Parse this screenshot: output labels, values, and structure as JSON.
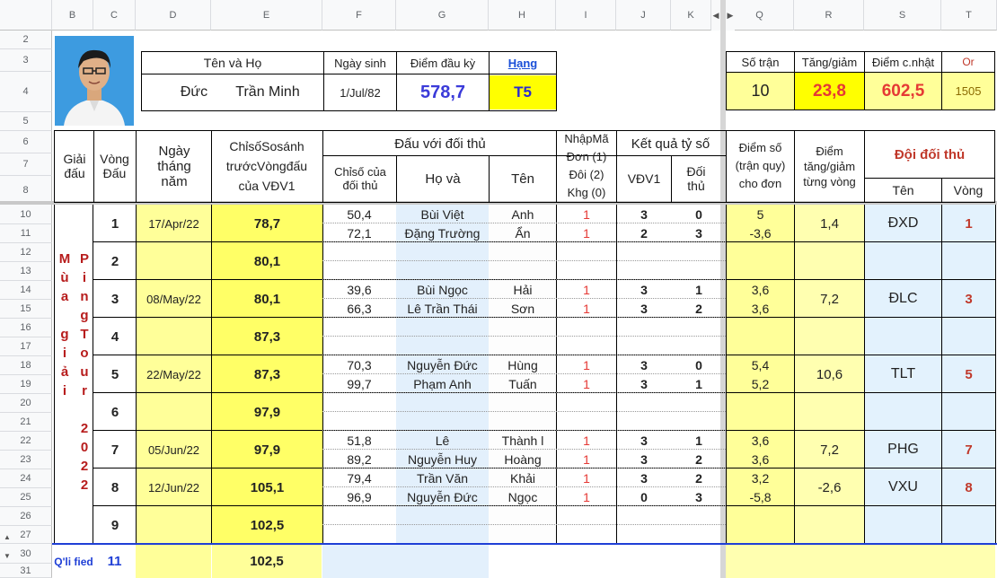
{
  "col_headers": [
    "B",
    "C",
    "D",
    "E",
    "F",
    "G",
    "H",
    "I",
    "J",
    "K",
    "Q",
    "R",
    "S",
    "T"
  ],
  "row_headers": [
    "2",
    "3",
    "4",
    "5",
    "6",
    "7",
    "8",
    "10",
    "11",
    "12",
    "13",
    "14",
    "15",
    "16",
    "17",
    "18",
    "19",
    "20",
    "21",
    "22",
    "23",
    "24",
    "25",
    "26",
    "27",
    "30",
    "31"
  ],
  "info": {
    "ten_va_ho": "Tên    và    Họ",
    "ngay_sinh_label": "Ngày sinh",
    "diem_dau_ky_label": "Điểm đầu kỳ",
    "hang_label": "Hạng",
    "first_name": "Đức",
    "last_name": "Trần Minh",
    "dob": "1/Jul/82",
    "diem_dau_ky": "578,7",
    "hang": "T5"
  },
  "summary": {
    "so_tran_label": "Số trận",
    "tang_giam_label": "Tăng/giảm",
    "diem_cn_label": "Điểm c.nhật",
    "or_label": "Or",
    "so_tran": "10",
    "tang_giam": "23,8",
    "diem_cn": "602,5",
    "or_val": "1505"
  },
  "headers": {
    "giai_dau": "Giải đấu",
    "vong_dau": "Vòng Đấu",
    "ngay": "Ngày tháng năm",
    "chiso": "ChỉsốSosánh trướcVòngđấu của VĐV1",
    "dau_voi": "Đấu với đối thủ",
    "chiso_dt": "Chỉsố của đối thủ",
    "ho_va": "Họ   và",
    "ten": "Tên",
    "nhap_ma": "NhậpMã Đơn (1) Đôi (2) Khg (0)",
    "ket_qua": "Kết quả tỷ số",
    "vdv1": "VĐV1",
    "doi_thu": "Đối thủ",
    "diem_so": "Điểm số (trận quy) cho đơn",
    "diem_tg": "Điểm tăng/giảm từng vòng",
    "doi_doi_thu": "Đội đối thủ",
    "ten2": "Tên",
    "vong2": "Vòng"
  },
  "tournament": {
    "col1": [
      "M",
      "ù",
      "a",
      "",
      "g",
      "i",
      "ả",
      "i"
    ],
    "col2": [
      "P",
      "i",
      "n",
      "g",
      "T",
      "o",
      "u",
      "r",
      "",
      "2",
      "0",
      "2",
      "2"
    ]
  },
  "matches": [
    {
      "round": "1",
      "date": "17/Apr/22",
      "index": "78,7",
      "diem_tg": "1,4",
      "team": "ĐXD",
      "team_round": "1",
      "games": [
        {
          "opp": "50,4",
          "ho": "Bùi Việt",
          "ten": "Anh",
          "code": "1",
          "s1": "3",
          "s2": "0",
          "pts": "5"
        },
        {
          "opp": "72,1",
          "ho": "Đặng Trường",
          "ten": "Ẩn",
          "code": "1",
          "s1": "2",
          "s2": "3",
          "pts": "-3,6"
        }
      ]
    },
    {
      "round": "2",
      "date": "",
      "index": "80,1",
      "diem_tg": "",
      "team": "",
      "team_round": "",
      "games": []
    },
    {
      "round": "3",
      "date": "08/May/22",
      "index": "80,1",
      "diem_tg": "7,2",
      "team": "ĐLC",
      "team_round": "3",
      "games": [
        {
          "opp": "39,6",
          "ho": "Bùi Ngọc",
          "ten": "Hải",
          "code": "1",
          "s1": "3",
          "s2": "1",
          "pts": "3,6"
        },
        {
          "opp": "66,3",
          "ho": "Lê Trần Thái",
          "ten": "Sơn",
          "code": "1",
          "s1": "3",
          "s2": "2",
          "pts": "3,6"
        }
      ]
    },
    {
      "round": "4",
      "date": "",
      "index": "87,3",
      "diem_tg": "",
      "team": "",
      "team_round": "",
      "games": []
    },
    {
      "round": "5",
      "date": "22/May/22",
      "index": "87,3",
      "diem_tg": "10,6",
      "team": "TLT",
      "team_round": "5",
      "games": [
        {
          "opp": "70,3",
          "ho": "Nguyễn Đức",
          "ten": "Hùng",
          "code": "1",
          "s1": "3",
          "s2": "0",
          "pts": "5,4"
        },
        {
          "opp": "99,7",
          "ho": "Phạm Anh",
          "ten": "Tuấn",
          "code": "1",
          "s1": "3",
          "s2": "1",
          "pts": "5,2"
        }
      ]
    },
    {
      "round": "6",
      "date": "",
      "index": "97,9",
      "diem_tg": "",
      "team": "",
      "team_round": "",
      "games": []
    },
    {
      "round": "7",
      "date": "05/Jun/22",
      "index": "97,9",
      "diem_tg": "7,2",
      "team": "PHG",
      "team_round": "7",
      "games": [
        {
          "opp": "51,8",
          "ho": "Lê",
          "ten": "Thành l",
          "code": "1",
          "s1": "3",
          "s2": "1",
          "pts": "3,6"
        },
        {
          "opp": "89,2",
          "ho": "Nguyễn Huy",
          "ten": "Hoàng",
          "code": "1",
          "s1": "3",
          "s2": "2",
          "pts": "3,6"
        }
      ]
    },
    {
      "round": "8",
      "date": "12/Jun/22",
      "index": "105,1",
      "diem_tg": "-2,6",
      "team": "VXU",
      "team_round": "8",
      "games": [
        {
          "opp": "79,4",
          "ho": "Trần Văn",
          "ten": "Khải",
          "code": "1",
          "s1": "3",
          "s2": "2",
          "pts": "3,2"
        },
        {
          "opp": "96,9",
          "ho": "Nguyễn Đức",
          "ten": "Ngọc",
          "code": "1",
          "s1": "0",
          "s2": "3",
          "pts": "-5,8"
        }
      ]
    },
    {
      "round": "9",
      "date": "",
      "index": "102,5",
      "diem_tg": "",
      "team": "",
      "team_round": "",
      "games": []
    }
  ],
  "bottom": {
    "tourn": "Q'li fied",
    "round": "11",
    "index": "102,5"
  }
}
